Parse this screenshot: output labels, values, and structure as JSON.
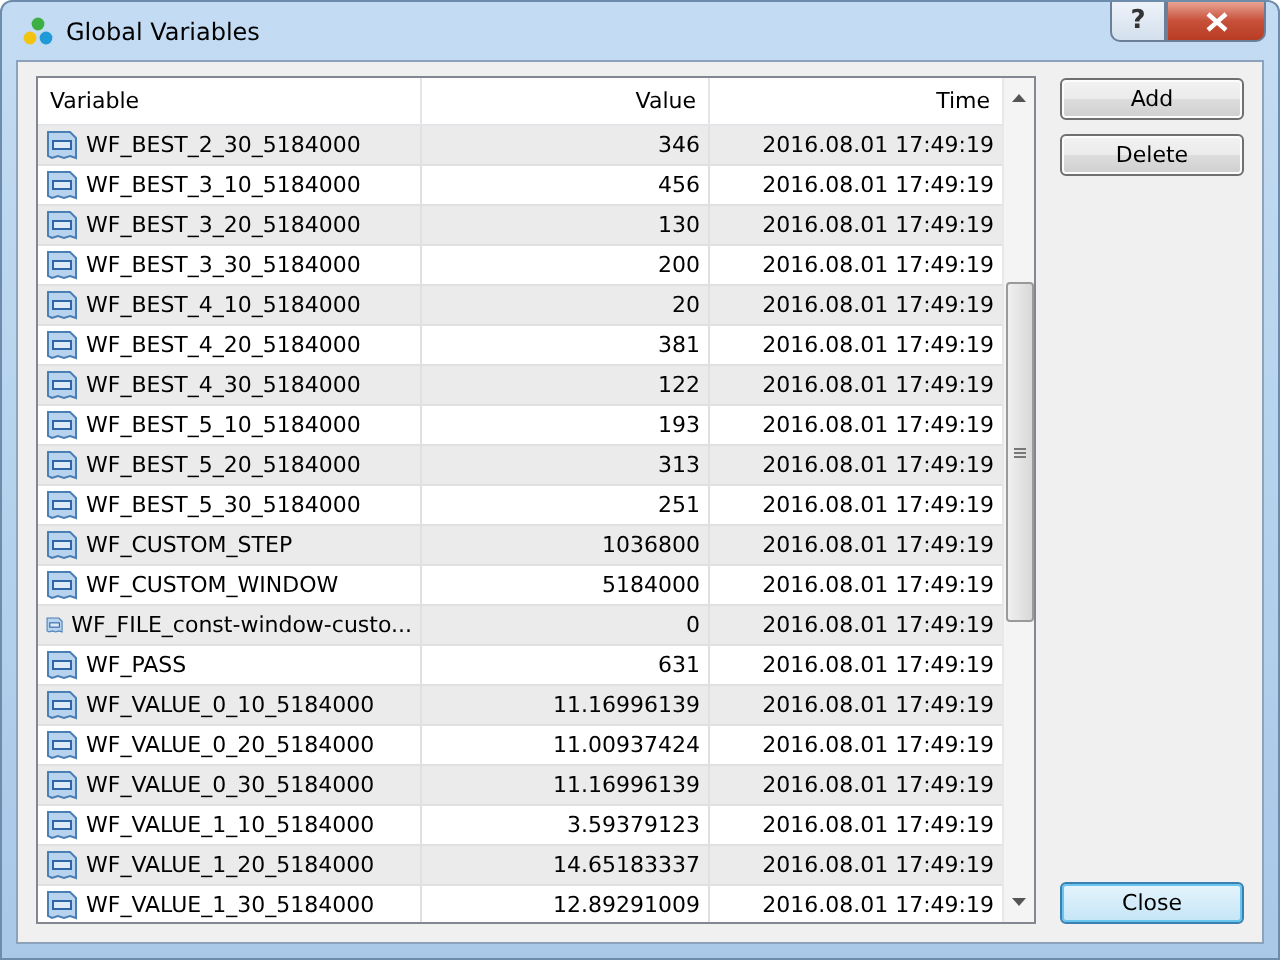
{
  "window": {
    "title": "Global Variables",
    "buttons": [
      "?"
    ]
  },
  "table": {
    "columns": [
      "Variable",
      "Value",
      "Time"
    ],
    "rows": [
      {
        "variable": "WF_BEST_2_30_5184000",
        "value": "346",
        "time": "2016.08.01 17:49:19"
      },
      {
        "variable": "WF_BEST_3_10_5184000",
        "value": "456",
        "time": "2016.08.01 17:49:19"
      },
      {
        "variable": "WF_BEST_3_20_5184000",
        "value": "130",
        "time": "2016.08.01 17:49:19"
      },
      {
        "variable": "WF_BEST_3_30_5184000",
        "value": "200",
        "time": "2016.08.01 17:49:19"
      },
      {
        "variable": "WF_BEST_4_10_5184000",
        "value": "20",
        "time": "2016.08.01 17:49:19"
      },
      {
        "variable": "WF_BEST_4_20_5184000",
        "value": "381",
        "time": "2016.08.01 17:49:19"
      },
      {
        "variable": "WF_BEST_4_30_5184000",
        "value": "122",
        "time": "2016.08.01 17:49:19"
      },
      {
        "variable": "WF_BEST_5_10_5184000",
        "value": "193",
        "time": "2016.08.01 17:49:19"
      },
      {
        "variable": "WF_BEST_5_20_5184000",
        "value": "313",
        "time": "2016.08.01 17:49:19"
      },
      {
        "variable": "WF_BEST_5_30_5184000",
        "value": "251",
        "time": "2016.08.01 17:49:19"
      },
      {
        "variable": "WF_CUSTOM_STEP",
        "value": "1036800",
        "time": "2016.08.01 17:49:19"
      },
      {
        "variable": "WF_CUSTOM_WINDOW",
        "value": "5184000",
        "time": "2016.08.01 17:49:19"
      },
      {
        "variable": "WF_FILE_const-window-custo...",
        "value": "0",
        "time": "2016.08.01 17:49:19"
      },
      {
        "variable": "WF_PASS",
        "value": "631",
        "time": "2016.08.01 17:49:19"
      },
      {
        "variable": "WF_VALUE_0_10_5184000",
        "value": "11.16996139",
        "time": "2016.08.01 17:49:19"
      },
      {
        "variable": "WF_VALUE_0_20_5184000",
        "value": "11.00937424",
        "time": "2016.08.01 17:49:19"
      },
      {
        "variable": "WF_VALUE_0_30_5184000",
        "value": "11.16996139",
        "time": "2016.08.01 17:49:19"
      },
      {
        "variable": "WF_VALUE_1_10_5184000",
        "value": "3.59379123",
        "time": "2016.08.01 17:49:19"
      },
      {
        "variable": "WF_VALUE_1_20_5184000",
        "value": "14.65183337",
        "time": "2016.08.01 17:49:19"
      },
      {
        "variable": "WF_VALUE_1_30_5184000",
        "value": "12.89291009",
        "time": "2016.08.01 17:49:19"
      }
    ]
  },
  "buttons": [
    {
      "label": "Add",
      "default": false
    },
    {
      "label": "Delete",
      "default": false
    },
    {
      "label": "Close",
      "default": true
    }
  ]
}
